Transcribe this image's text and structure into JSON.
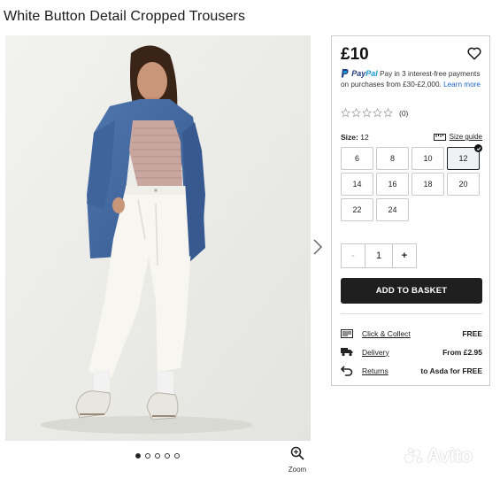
{
  "product": {
    "title": "White Button Detail Cropped Trousers",
    "image_alt": "Model wearing white cropped trousers with a denim jacket"
  },
  "gallery": {
    "dot_count": 5,
    "active_dot": 0,
    "zoom_label": "Zoom"
  },
  "panel": {
    "price": "£10",
    "paypal": {
      "brand_pay": "Pay",
      "brand_pal": "Pal",
      "text": "Pay in 3 interest-free payments on purchases from £30-£2,000.",
      "link": "Learn more"
    },
    "rating": {
      "stars_filled": 0,
      "stars_total": 5,
      "count_label": "(0)"
    },
    "size": {
      "label": "Size:",
      "selected": "12",
      "guide_label": "Size guide",
      "options": [
        "6",
        "8",
        "10",
        "12",
        "14",
        "16",
        "18",
        "20",
        "22",
        "24"
      ]
    },
    "quantity": {
      "minus": "-",
      "value": "1",
      "plus": "+"
    },
    "add_to_basket": "ADD TO BASKET",
    "delivery": [
      {
        "icon": "click-collect-icon",
        "label": "Click & Collect",
        "value": "FREE",
        "bold": true
      },
      {
        "icon": "delivery-truck-icon",
        "label": "Delivery",
        "value": "From £2.95",
        "bold": true
      },
      {
        "icon": "returns-icon",
        "label": "Returns",
        "value": "to Asda for FREE",
        "bold": true
      }
    ]
  },
  "watermark": {
    "text": "Avito"
  }
}
